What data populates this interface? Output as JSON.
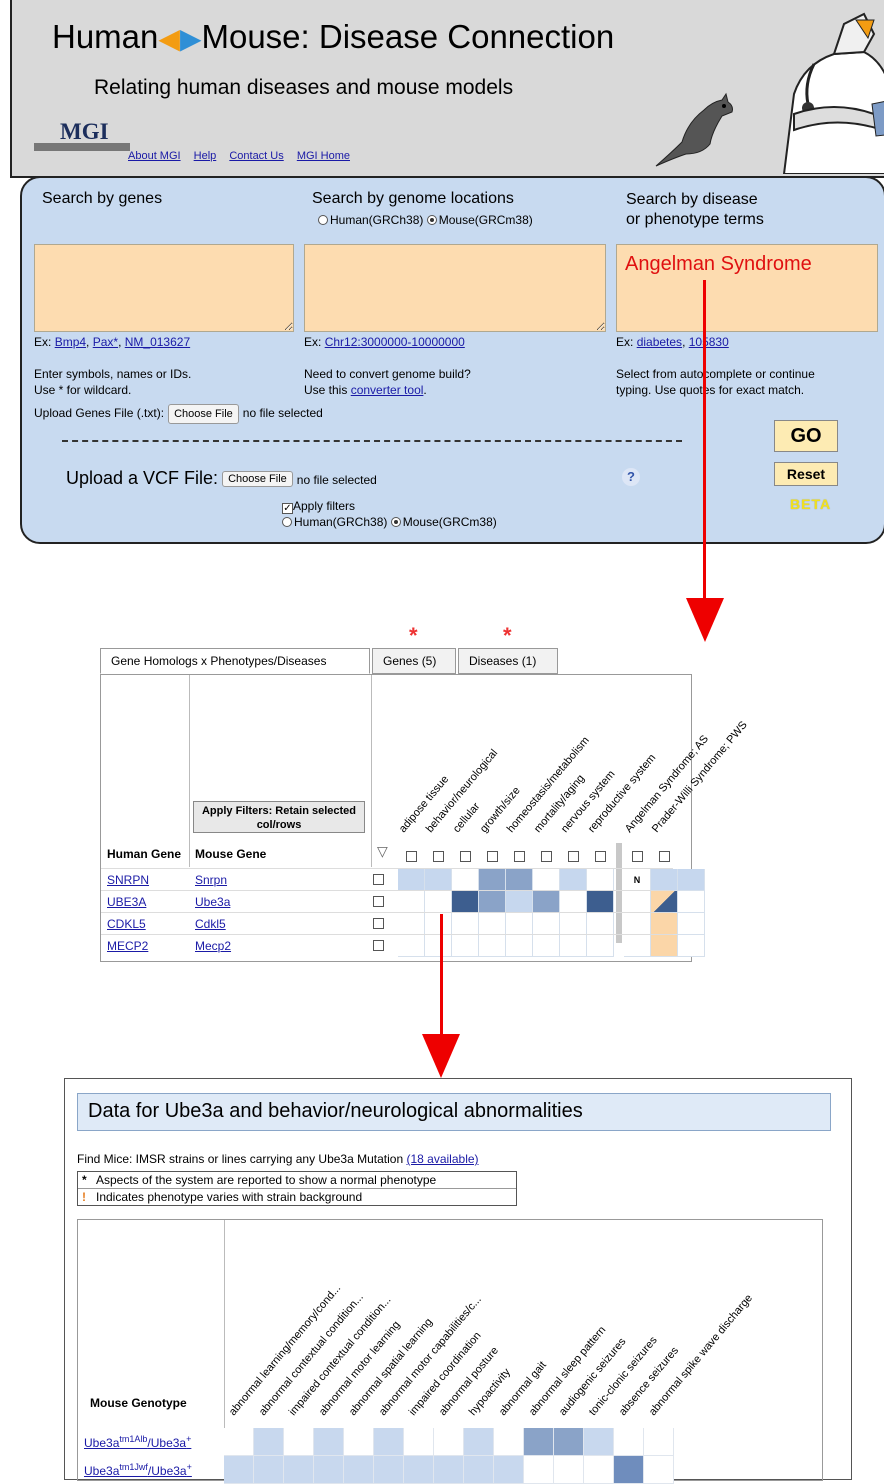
{
  "header": {
    "title_left": "Human",
    "title_right": "Mouse: Disease Connection",
    "subtitle": "Relating human diseases and mouse models",
    "logo_text": "MGI",
    "links": [
      "About MGI",
      "Help",
      "Contact Us",
      "MGI Home"
    ]
  },
  "search": {
    "genes": {
      "label": "Search by genes",
      "example_prefix": "Ex:",
      "examples": [
        "Bmp4",
        "Pax*",
        "NM_013627"
      ],
      "help_line1": "Enter symbols, names or IDs.",
      "help_line2": "Use * for wildcard.",
      "upload_label": "Upload Genes File (.txt):",
      "choose_file": "Choose File",
      "no_file": "no file selected"
    },
    "genome": {
      "label": "Search by genome locations",
      "radio_human": "Human(GRCh38)",
      "radio_mouse": "Mouse(GRCm38)",
      "example_prefix": "Ex:",
      "example": "Chr12:3000000-10000000",
      "help_line1": "Need to convert genome build?",
      "help_line2_prefix": "Use this",
      "help_line2_link": "converter tool",
      "help_line2_suffix": "."
    },
    "disease": {
      "label_line1": "Search by disease",
      "label_line2": "or phenotype terms",
      "value": "Angelman Syndrome",
      "example_prefix": "Ex:",
      "examples": [
        "diabetes",
        "105830"
      ],
      "help_line1": "Select from autocomplete or continue",
      "help_line2": "typing. Use quotes for exact match."
    },
    "vcf": {
      "label": "Upload a VCF File:",
      "choose_file": "Choose File",
      "no_file": "no file selected",
      "apply_filters": "Apply filters",
      "radio_human": "Human(GRCh38)",
      "radio_mouse": "Mouse(GRCm38)"
    },
    "help_icon": "?",
    "go": "GO",
    "reset": "Reset",
    "beta": "BETA"
  },
  "grid": {
    "tabs": [
      "Gene Homologs x Phenotypes/Diseases",
      "Genes (5)",
      "Diseases (1)"
    ],
    "tab_stars": [
      "*",
      "*"
    ],
    "apply_filters": "Apply Filters: Retain selected col/rows",
    "col_human": "Human Gene",
    "col_mouse": "Mouse Gene",
    "phenotypes": [
      "adipose tissue",
      "behavior/neurological",
      "cellular",
      "growth/size",
      "homeostasis/metabolism",
      "mortality/aging",
      "nervous system",
      "reproductive system"
    ],
    "diseases": [
      "Angelman Syndrome; AS",
      "Prader-Willi Syndrome; PWS"
    ],
    "rows": [
      {
        "human": "SNRPN",
        "mouse": "Snrpn",
        "cells": [
          1,
          1,
          0,
          3,
          3,
          0,
          1,
          0,
          "N",
          1,
          1
        ]
      },
      {
        "human": "UBE3A",
        "mouse": "Ube3a",
        "cells": [
          0,
          0,
          5,
          3,
          1,
          3,
          0,
          5,
          0,
          "tri",
          0
        ]
      },
      {
        "human": "CDKL5",
        "mouse": "Cdkl5",
        "cells": [
          0,
          0,
          0,
          0,
          0,
          0,
          0,
          0,
          0,
          "o",
          0
        ]
      },
      {
        "human": "MECP2",
        "mouse": "Mecp2",
        "cells": [
          0,
          0,
          0,
          0,
          0,
          0,
          0,
          0,
          0,
          "o",
          0
        ]
      }
    ],
    "colors": {
      "1": "#c6d7ee",
      "2": "#aabfe0",
      "3": "#8aa3c8",
      "5": "#3d5e8f",
      "o": "#fbd6a8"
    }
  },
  "data_panel": {
    "title": "Data for Ube3a and behavior/neurological abnormalities",
    "find_mice_prefix": "Find Mice: IMSR strains or lines carrying any Ube3a Mutation",
    "find_mice_link": "(18 available)",
    "legend": [
      {
        "symbol": "*",
        "text": "Aspects of the system are reported to show a normal phenotype"
      },
      {
        "symbol": "!",
        "text": "Indicates phenotype varies with strain background"
      }
    ],
    "genotype_header": "Mouse Genotype",
    "columns": [
      "abnormal learning/memory/cond...",
      "abnormal contextual condition...",
      "impaired contextual condition...",
      "abnormal motor learning",
      "abnormal spatial learning",
      "abnormal motor capabilities/c...",
      "impaired coordination",
      "abnormal posture",
      "hypoactivity",
      "abnormal gait",
      "abnormal sleep pattern",
      "audiogenic seizures",
      "tonic-clonic seizures",
      "absence seizures",
      "abnormal spike wave discharge"
    ],
    "rows": [
      {
        "base": "Ube3a",
        "sup": "tm1Alb",
        "rest": "/Ube3a",
        "sup2": "+",
        "cells": [
          0,
          1,
          0,
          1,
          0,
          1,
          0,
          0,
          1,
          0,
          2,
          2,
          1,
          0,
          0
        ]
      },
      {
        "base": "Ube3a",
        "sup": "tm1Jwf",
        "rest": "/Ube3a",
        "sup2": "+",
        "cells": [
          1,
          1,
          1,
          1,
          1,
          1,
          1,
          1,
          1,
          1,
          0,
          0,
          0,
          3,
          0
        ]
      }
    ],
    "colors": {
      "1": "#c8d8ee",
      "2": "#8aa3c8",
      "3": "#6f8dbd"
    }
  }
}
